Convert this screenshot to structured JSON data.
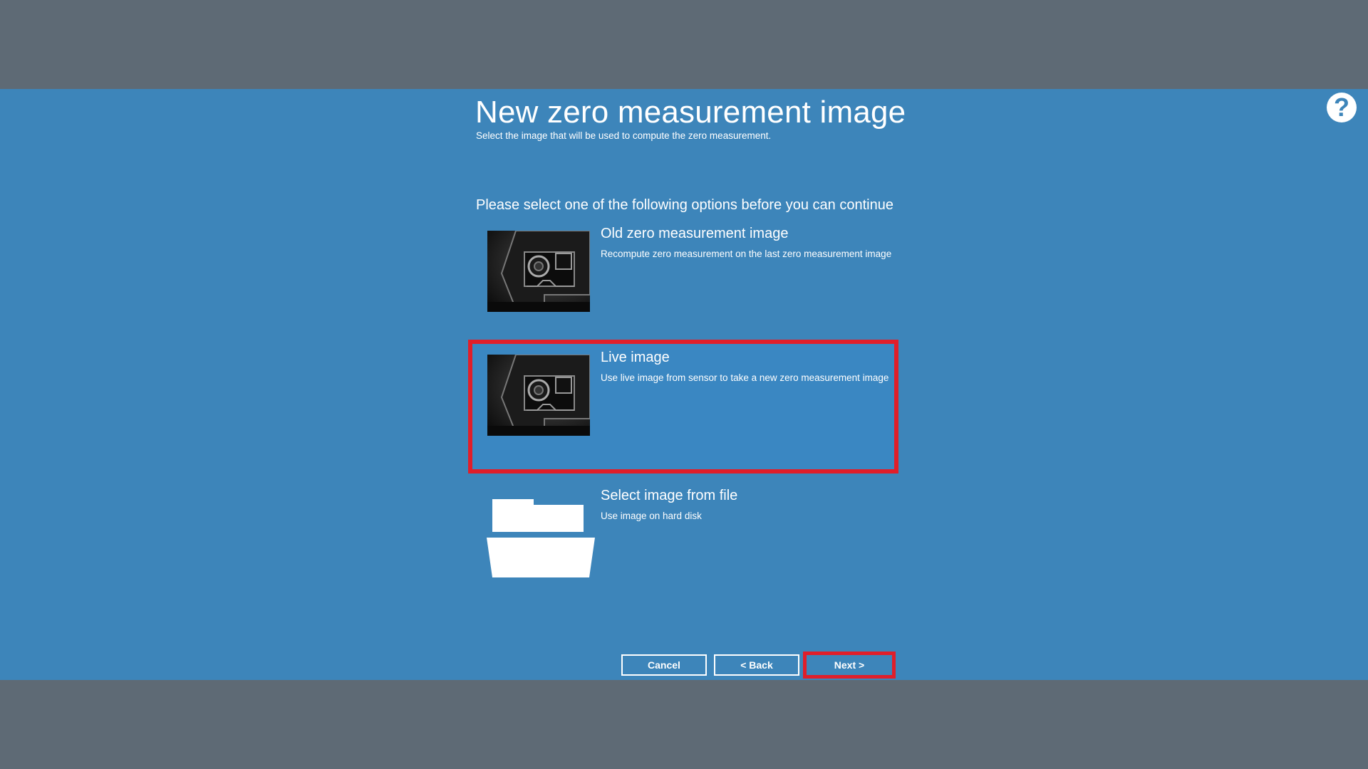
{
  "dialog": {
    "title": "New zero measurement image",
    "subtitle": "Select the image that will be used to compute the zero measurement.",
    "prompt": "Please select one of the following options before you can continue",
    "help_icon": "question-circle-icon",
    "help_glyph": "?"
  },
  "options": [
    {
      "title": "Old zero measurement image",
      "description": "Recompute zero measurement on the last zero measurement image",
      "icon": "sensor-image-thumbnail",
      "selected": false
    },
    {
      "title": "Live image",
      "description": "Use live image from sensor to take a new zero measurement image",
      "icon": "sensor-image-thumbnail",
      "selected": true
    },
    {
      "title": "Select image from file",
      "description": "Use image on hard disk",
      "icon": "folder-icon",
      "selected": false
    }
  ],
  "buttons": {
    "cancel": "Cancel",
    "back": "< Back",
    "next": "Next >"
  },
  "colors": {
    "dialog_bg": "#3d85ba",
    "backdrop": "#5e6a75",
    "highlight": "#e01e2a",
    "text": "#ffffff"
  }
}
